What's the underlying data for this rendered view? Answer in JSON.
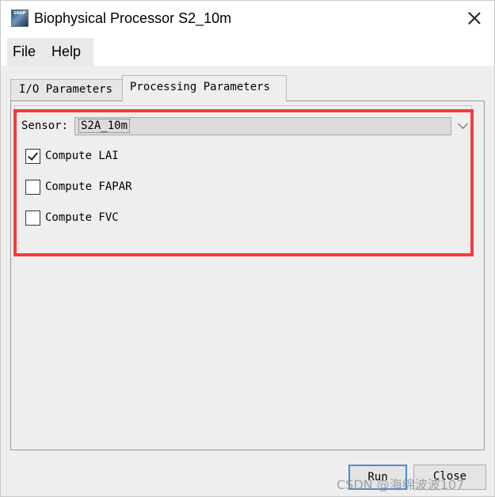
{
  "window": {
    "title": "Biophysical Processor S2_10m",
    "app_icon_text": "SNAP"
  },
  "menu": [
    "File",
    "Help"
  ],
  "tabs": [
    "I/O Parameters",
    "Processing Parameters"
  ],
  "sensor": {
    "label": "Sensor:",
    "value": "S2A_10m"
  },
  "options": [
    {
      "label": "Compute LAI",
      "checked": true
    },
    {
      "label": "Compute FAPAR",
      "checked": false
    },
    {
      "label": "Compute FVC",
      "checked": false
    }
  ],
  "buttons": {
    "run": "Run",
    "close": "Close"
  },
  "watermark": "CSDN @海绵波波107",
  "colors": {
    "highlight": "#f43c3c",
    "focus_border": "#4a8cd8"
  }
}
